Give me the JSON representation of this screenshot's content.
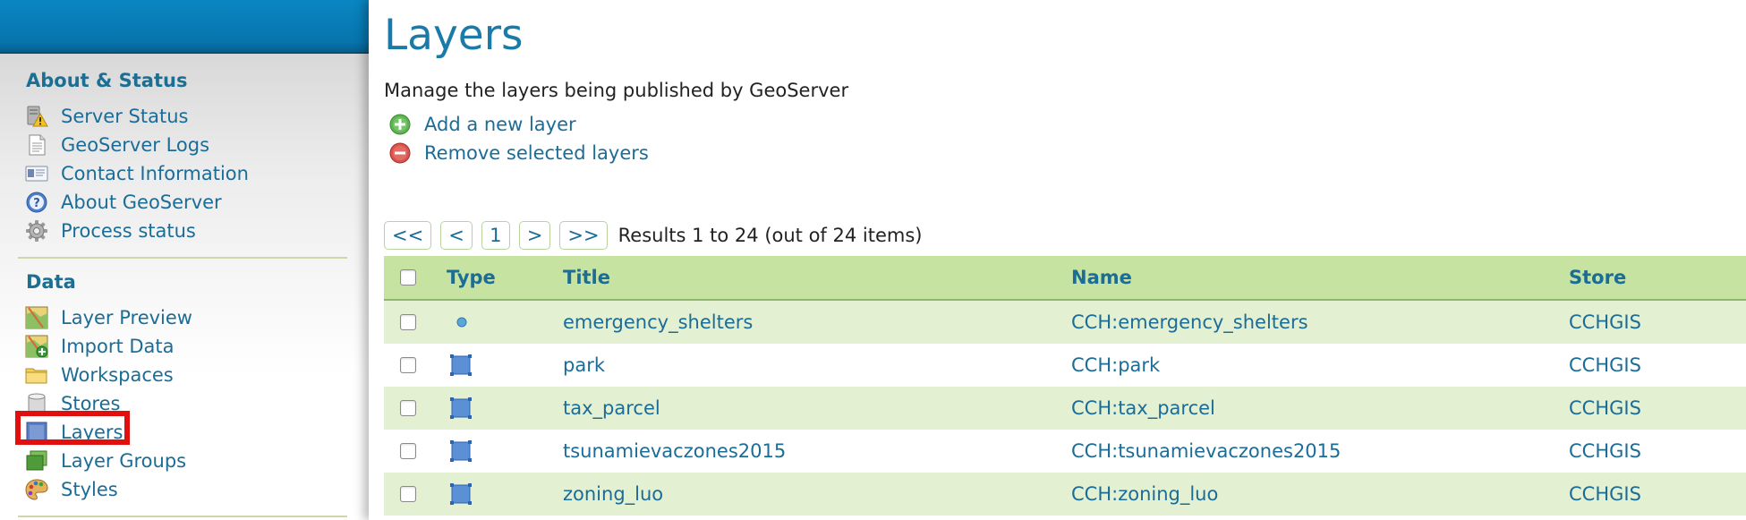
{
  "sidebar": {
    "about_section_title": "About & Status",
    "about_items": [
      {
        "label": "Server Status",
        "icon": "server-status-icon"
      },
      {
        "label": "GeoServer Logs",
        "icon": "document-icon"
      },
      {
        "label": "Contact Information",
        "icon": "contact-card-icon"
      },
      {
        "label": "About GeoServer",
        "icon": "help-icon"
      },
      {
        "label": "Process status",
        "icon": "gear-icon"
      }
    ],
    "data_section_title": "Data",
    "data_items": [
      {
        "label": "Layer Preview",
        "icon": "map-preview-icon"
      },
      {
        "label": "Import Data",
        "icon": "import-map-icon"
      },
      {
        "label": "Workspaces",
        "icon": "folder-icon"
      },
      {
        "label": "Stores",
        "icon": "database-icon"
      },
      {
        "label": "Layers",
        "icon": "layer-icon"
      },
      {
        "label": "Layer Groups",
        "icon": "layer-group-icon"
      },
      {
        "label": "Styles",
        "icon": "palette-icon"
      }
    ]
  },
  "main": {
    "title": "Layers",
    "description": "Manage the layers being published by GeoServer",
    "add_label": "Add a new layer",
    "remove_label": "Remove selected layers"
  },
  "pager": {
    "first": "<<",
    "prev": "<",
    "page": "1",
    "next": ">",
    "last": ">>",
    "results": "Results 1 to 24 (out of 24 items)"
  },
  "table": {
    "headers": {
      "type": "Type",
      "title": "Title",
      "name": "Name",
      "store": "Store"
    },
    "rows": [
      {
        "type": "point",
        "title": "emergency_shelters",
        "name": "CCH:emergency_shelters",
        "store": "CCHGIS"
      },
      {
        "type": "polygon",
        "title": "park",
        "name": "CCH:park",
        "store": "CCHGIS"
      },
      {
        "type": "polygon",
        "title": "tax_parcel",
        "name": "CCH:tax_parcel",
        "store": "CCHGIS"
      },
      {
        "type": "polygon",
        "title": "tsunamievaczones2015",
        "name": "CCH:tsunamievaczones2015",
        "store": "CCHGIS"
      },
      {
        "type": "polygon",
        "title": "zoning_luo",
        "name": "CCH:zoning_luo",
        "store": "CCHGIS"
      }
    ]
  },
  "colors": {
    "link": "#1b6c96",
    "header_bg": "#c7e3a2",
    "row_alt_bg": "#e3f0d2",
    "highlight": "#e20f0f",
    "topbar": "#0a86c2"
  }
}
